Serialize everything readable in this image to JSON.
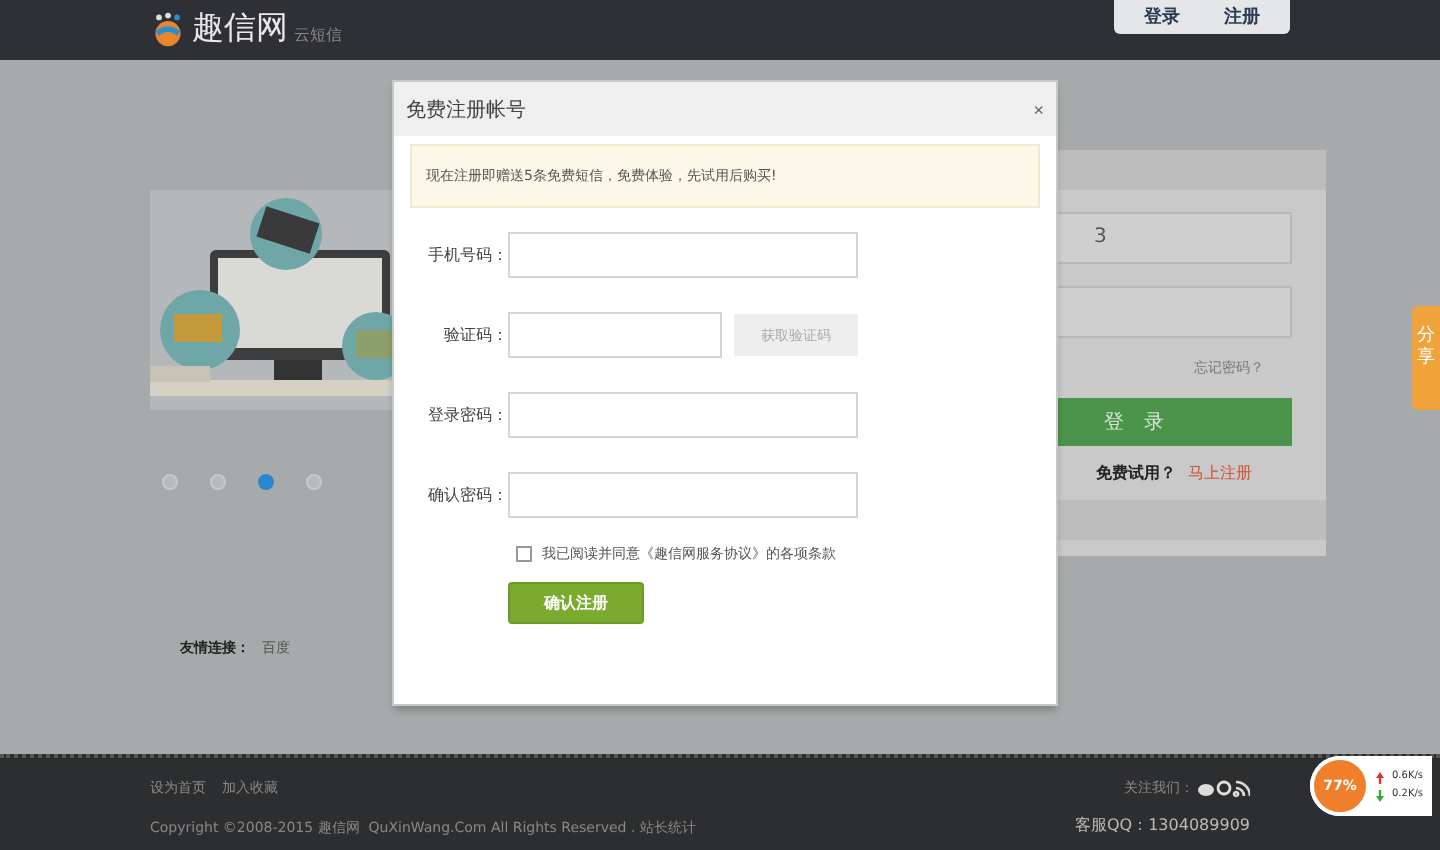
{
  "header": {
    "logo_text": "趣信网",
    "logo_sub": "云短信",
    "buttons": [
      {
        "label": "登录"
      },
      {
        "label": "注册"
      }
    ]
  },
  "slider": {
    "kind": "picture",
    "dots": [
      {
        "selected": false
      },
      {
        "selected": false
      },
      {
        "selected": true
      },
      {
        "selected": false
      }
    ]
  },
  "friend_links": {
    "label": "友情连接：",
    "links": [
      "百度"
    ]
  },
  "login_panel": {
    "username_value": "3",
    "forgot": "忘记密码？",
    "login_button": "登　录",
    "trial_text": "免费试用？",
    "register_link": "马上注册"
  },
  "share_tab": "分享",
  "modal": {
    "title": "免费注册帐号",
    "close": "×",
    "notice": "现在注册即赠送5条免费短信，免费体验，先试用后购买!",
    "fields": [
      {
        "label": "手机号码：",
        "kind": "input"
      },
      {
        "label": "验证码：",
        "kind": "code",
        "button": "获取验证码",
        "disabled": true
      },
      {
        "label": "登录密码：",
        "kind": "input"
      },
      {
        "label": "确认密码：",
        "kind": "input"
      }
    ],
    "agreement": {
      "checked": false,
      "text": "我已阅读并同意《趣信网服务协议》的各项条款"
    },
    "submit": "确认注册"
  },
  "footer": {
    "links": [
      "设为首页",
      "加入收藏"
    ],
    "copyright": "Copyright ©2008-2015 趣信网  QuXinWang.Com All Rights Reserved . 站长统计",
    "follow": "关注我们：",
    "qq": "客服QQ：1304089909"
  },
  "speed_widget": {
    "percent": "77%",
    "up": "0.6K/s",
    "down": "0.2K/s"
  }
}
